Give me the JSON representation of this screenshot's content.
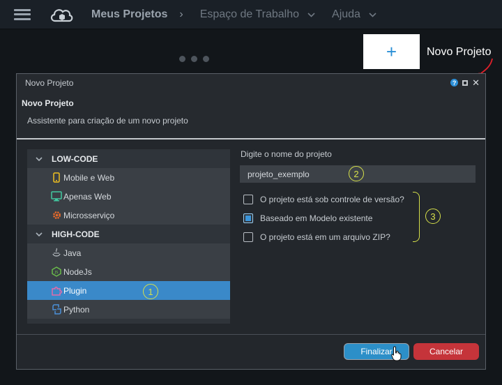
{
  "topbar": {
    "title": "Meus Projetos",
    "breadcrumb_sep": "›",
    "workspace": "Espaço de Trabalho",
    "help": "Ajuda"
  },
  "tile": {
    "plus": "+",
    "label": "Novo Projeto"
  },
  "dialog": {
    "window_title": "Novo Projeto",
    "heading": "Novo Projeto",
    "subtitle": "Assistente para criação de um novo projeto",
    "help_glyph": "?",
    "close_glyph": "✕",
    "tree": {
      "groups": [
        {
          "label": "LOW-CODE",
          "items": [
            {
              "label": "Mobile e Web",
              "icon": "mobile-icon"
            },
            {
              "label": "Apenas Web",
              "icon": "monitor-icon"
            },
            {
              "label": "Microsserviço",
              "icon": "gear-icon"
            }
          ]
        },
        {
          "label": "HIGH-CODE",
          "items": [
            {
              "label": "Java",
              "icon": "java-icon"
            },
            {
              "label": "NodeJs",
              "icon": "nodejs-icon"
            },
            {
              "label": "Plugin",
              "icon": "puzzle-icon",
              "selected": true
            },
            {
              "label": "Python",
              "icon": "python-icon"
            }
          ]
        }
      ]
    },
    "form": {
      "name_label": "Digite o nome do projeto",
      "name_value": "projeto_exemplo",
      "checks": [
        {
          "label": "O projeto está sob controle de versão?",
          "checked": false
        },
        {
          "label": "Baseado em Modelo existente",
          "checked": true
        },
        {
          "label": "O projeto está em um arquivo ZIP?",
          "checked": false
        }
      ]
    },
    "buttons": {
      "finish": "Finalizar",
      "cancel": "Cancelar"
    }
  },
  "annotations": {
    "one": "1",
    "two": "2",
    "three": "3"
  },
  "colors": {
    "accent": "#2c8fd8",
    "selected_row": "#3a89c9",
    "cancel": "#c5343a",
    "annotation": "#d6e04a",
    "callout_arrow": "#e0202a"
  }
}
